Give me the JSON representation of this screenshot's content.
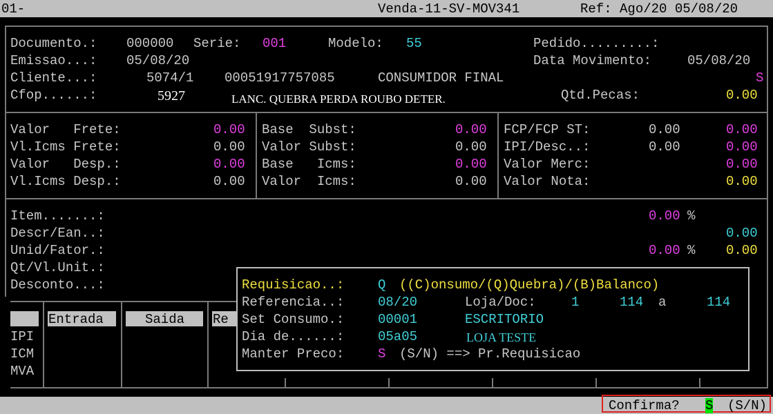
{
  "titlebar": {
    "left": "01-",
    "program": "Venda-11-SV-MOV341",
    "ref": "Ref: Ago/20 05/08/20"
  },
  "header": {
    "documento_label": "Documento.:",
    "documento_value": "000000",
    "serie_label": "Serie:",
    "serie_value": "001",
    "modelo_label": "Modelo:",
    "modelo_value": "55",
    "pedido_label": "Pedido.........:",
    "emissao_label": "Emissao...:",
    "emissao_value": "05/08/20",
    "data_mov_label": "Data Movimento:",
    "data_mov_value": "05/08/20",
    "cliente_label": "Cliente...:",
    "cliente_code": "5074/1",
    "cliente_doc": "00051917757085",
    "cliente_name": "CONSUMIDOR FINAL",
    "cliente_flag": "S",
    "cfop_label": "Cfop......:",
    "cfop_value": "5927",
    "cfop_desc": "LANC. QUEBRA PERDA ROUBO DETER.",
    "qtd_pecas_label": "Qtd.Pecas:",
    "qtd_pecas_value": "0.00"
  },
  "totals": {
    "col1": [
      {
        "label": "Valor   Frete:",
        "value": "0.00",
        "color": "#e040e0"
      },
      {
        "label": "Vl.Icms Frete:",
        "value": "0.00",
        "color": "#c8c8c8"
      },
      {
        "label": "Valor   Desp.:",
        "value": "0.00",
        "color": "#e040e0"
      },
      {
        "label": "Vl.Icms Desp.:",
        "value": "0.00",
        "color": "#c8c8c8"
      }
    ],
    "col2": [
      {
        "label": "Base  Subst:",
        "value": "0.00",
        "color": "#e040e0"
      },
      {
        "label": "Valor Subst:",
        "value": "0.00",
        "color": "#c8c8c8"
      },
      {
        "label": "Base   Icms:",
        "value": "0.00",
        "color": "#e040e0"
      },
      {
        "label": "Valor  Icms:",
        "value": "0.00",
        "color": "#c8c8c8"
      }
    ],
    "fcp_label": "FCP/FCP ST:",
    "fcp_v1": "0.00",
    "fcp_v2": "0.00",
    "ipi_label": "IPI/Desc..:",
    "ipi_v1": "0.00",
    "ipi_v2": "0.00",
    "merc_label": "Valor Merc:",
    "merc_value": "0.00",
    "nota_label": "Valor Nota:",
    "nota_value": "0.00"
  },
  "item": {
    "item_label": "Item.......:",
    "item_pct": "0.00",
    "pct_sign": "%",
    "descr_label": "Descr/Ean..:",
    "descr_value": "0.00",
    "unid_label": "Unid/Fator.:",
    "unid_pct": "0.00",
    "unid_value": "0.00",
    "qt_label": "Qt/Vl.Unit.:",
    "desconto_label": "Desconto...:"
  },
  "tax_grid": {
    "col_entrada": "Entrada",
    "col_saida": "Saida",
    "col_re": "Re",
    "rows": [
      "IPI",
      "ICM",
      "MVA"
    ]
  },
  "popup": {
    "requisicao_label": "Requisicao..:",
    "requisicao_value": "Q",
    "requisicao_options": "((C)onsumo/(Q)Quebra)/(B)Balanco)",
    "referencia_label": "Referencia..:",
    "referencia_value": "08/20",
    "loja_label": "Loja/Doc:",
    "loja_value": "1",
    "doc_from": "114",
    "doc_a": "a",
    "doc_to": "114",
    "set_label": "Set Consumo.:",
    "set_value": "00001",
    "set_name": "ESCRITORIO",
    "dia_label": "Dia de......:",
    "dia_value": "05a05",
    "dia_name": "LOJA TESTE",
    "manter_label": "Manter Preco:",
    "manter_value": "S",
    "manter_hint": "(S/N) ==> Pr.Requisicao"
  },
  "statusbar": {
    "confirm_label": "Confirma?",
    "confirm_value": "S",
    "confirm_hint": "(S/N)"
  }
}
